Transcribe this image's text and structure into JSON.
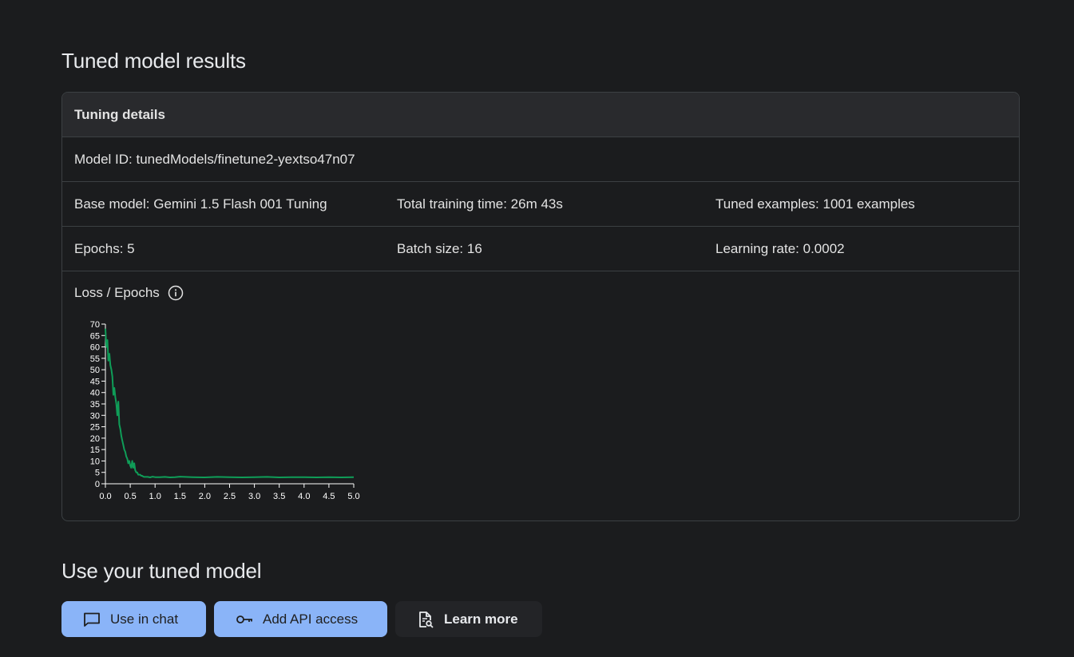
{
  "results": {
    "title": "Tuned model results"
  },
  "details": {
    "header": "Tuning details",
    "model_id": "Model ID: tunedModels/finetune2-yextso47n07",
    "base_model": "Base model: Gemini 1.5 Flash 001 Tuning",
    "training_time": "Total training time: 26m 43s",
    "tuned_examples": "Tuned examples: 1001 examples",
    "epochs": "Epochs: 5",
    "batch_size": "Batch size: 16",
    "learning_rate": "Learning rate: 0.0002",
    "chart_title": "Loss / Epochs",
    "info_icon": "info-icon"
  },
  "chart_data": {
    "type": "line",
    "title": "Loss / Epochs",
    "xlabel": "",
    "ylabel": "",
    "xlim": [
      0,
      5
    ],
    "ylim": [
      0,
      70
    ],
    "x_ticks": [
      "0.0",
      "0.5",
      "1.0",
      "1.5",
      "2.0",
      "2.5",
      "3.0",
      "3.5",
      "4.0",
      "4.5",
      "5.0"
    ],
    "y_ticks": [
      "0",
      "5",
      "10",
      "15",
      "20",
      "25",
      "30",
      "35",
      "40",
      "45",
      "50",
      "55",
      "60",
      "65",
      "70"
    ],
    "grid": false,
    "color": "#0f9d58",
    "series": [
      {
        "x": [
          0.0,
          0.02,
          0.04,
          0.06,
          0.08,
          0.1,
          0.12,
          0.14,
          0.16,
          0.18,
          0.2,
          0.22,
          0.24,
          0.26,
          0.28,
          0.3,
          0.32,
          0.34,
          0.36,
          0.38,
          0.4,
          0.42,
          0.44,
          0.46,
          0.48,
          0.5,
          0.52,
          0.54,
          0.56,
          0.58,
          0.6,
          0.62,
          0.64,
          0.66,
          0.68,
          0.7,
          0.72,
          0.74,
          0.76,
          0.78,
          0.8,
          0.85,
          0.9,
          0.95,
          1.0,
          1.1,
          1.2,
          1.3,
          1.4,
          1.5,
          1.75,
          2.0,
          2.25,
          2.5,
          2.75,
          3.0,
          3.25,
          3.5,
          3.75,
          4.0,
          4.25,
          4.5,
          4.75,
          5.0
        ],
        "values": [
          68,
          60,
          63,
          54,
          57,
          52,
          50,
          47,
          39,
          42,
          38,
          35,
          30,
          36,
          26,
          24,
          21,
          19,
          17,
          15,
          14,
          12,
          11,
          9,
          10,
          8,
          7,
          10,
          7,
          9,
          6,
          5,
          5,
          4,
          4,
          4,
          3.5,
          3.5,
          3.2,
          3,
          3,
          3,
          2.8,
          3.1,
          2.9,
          2.9,
          3,
          2.8,
          2.9,
          3.1,
          2.9,
          2.8,
          3,
          2.9,
          2.8,
          2.9,
          3,
          2.8,
          2.9,
          2.9,
          2.8,
          2.9,
          2.8,
          2.9
        ]
      }
    ]
  },
  "use": {
    "title": "Use your tuned model",
    "chat_label": "Use in chat",
    "api_label": "Add API access",
    "learn_label": "Learn more"
  }
}
